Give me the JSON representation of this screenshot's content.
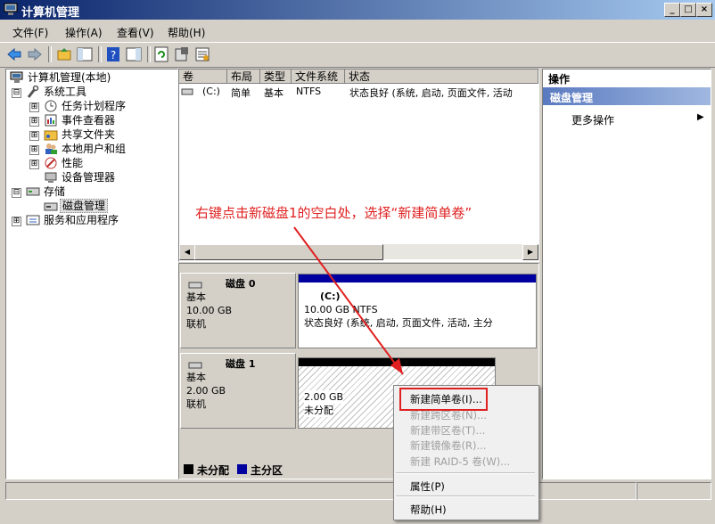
{
  "window": {
    "title": "计算机管理",
    "buttons": [
      "_",
      "□",
      "×"
    ]
  },
  "menu": [
    "文件(F)",
    "操作(A)",
    "查看(V)",
    "帮助(H)"
  ],
  "tree": {
    "root": "计算机管理(本地)",
    "items": [
      {
        "label": "系统工具",
        "expander": "⊟"
      },
      {
        "label": "任务计划程序",
        "expander": "⊞"
      },
      {
        "label": "事件查看器",
        "expander": "⊞"
      },
      {
        "label": "共享文件夹",
        "expander": "⊞"
      },
      {
        "label": "本地用户和组",
        "expander": "⊞"
      },
      {
        "label": "性能",
        "expander": "⊞"
      },
      {
        "label": "设备管理器",
        "expander": ""
      },
      {
        "label": "存储",
        "expander": "⊟"
      },
      {
        "label": "磁盘管理",
        "expander": ""
      },
      {
        "label": "服务和应用程序",
        "expander": "⊞"
      }
    ]
  },
  "volume_list": {
    "columns": [
      "卷",
      "布局",
      "类型",
      "文件系统",
      "状态"
    ],
    "rows": [
      {
        "vol": "(C:)",
        "layout": "简单",
        "type": "基本",
        "fs": "NTFS",
        "status": "状态良好 (系统, 启动, 页面文件, 活动"
      }
    ]
  },
  "disks": [
    {
      "name": "磁盘 0",
      "type": "基本",
      "size": "10.00 GB",
      "state": "联机",
      "partition": {
        "label": "(C:)",
        "detail": "10.00 GB NTFS",
        "status": "状态良好 (系统, 启动, 页面文件, 活动, 主分"
      }
    },
    {
      "name": "磁盘 1",
      "type": "基本",
      "size": "2.00 GB",
      "state": "联机",
      "partition": {
        "size": "2.00 GB",
        "status": "未分配"
      }
    }
  ],
  "legend": [
    {
      "label": "未分配",
      "color": "#000000"
    },
    {
      "label": "主分区",
      "color": "#0000a0"
    }
  ],
  "actions": {
    "header": "操作",
    "section": "磁盘管理",
    "more": "更多操作"
  },
  "context_menu": {
    "items": [
      {
        "label": "新建简单卷(I)...",
        "enabled": true
      },
      {
        "label": "新建跨区卷(N)...",
        "enabled": false
      },
      {
        "label": "新建带区卷(T)...",
        "enabled": false
      },
      {
        "label": "新建镜像卷(R)...",
        "enabled": false
      },
      {
        "label": "新建 RAID-5 卷(W)...",
        "enabled": false
      },
      {
        "label": "属性(P)",
        "enabled": true
      },
      {
        "label": "帮助(H)",
        "enabled": true
      }
    ]
  },
  "annotation": "右键点击新磁盘1的空白处，选择“新建简单卷”",
  "colors": {
    "annotation": "#e02020",
    "primary_partition": "#0000a0",
    "titlebar": "#0a246a"
  }
}
